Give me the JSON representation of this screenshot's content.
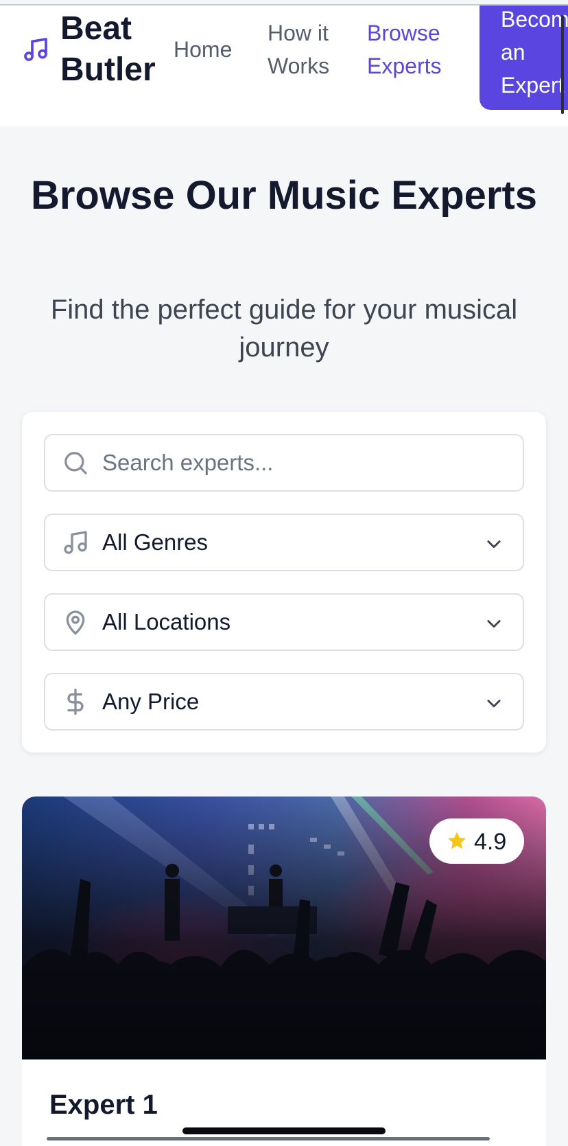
{
  "header": {
    "brand": "Beat\nButler",
    "logo_icon": "music-note-icon",
    "nav": [
      {
        "label": "Home",
        "active": false
      },
      {
        "label": "How it\nWorks",
        "active": false
      },
      {
        "label": "Browse\nExperts",
        "active": true
      }
    ],
    "cta_label": "Become\nan\nExpert"
  },
  "hero": {
    "title": "Browse Our Music Experts",
    "subtitle": "Find the perfect guide for your musical journey"
  },
  "filters": {
    "search": {
      "placeholder": "Search experts...",
      "icon": "search-icon"
    },
    "genre": {
      "value": "All Genres",
      "icon": "music-note-icon"
    },
    "location": {
      "value": "All Locations",
      "icon": "map-pin-icon"
    },
    "price": {
      "value": "Any Price",
      "icon": "dollar-icon"
    }
  },
  "experts": [
    {
      "name": "Expert 1",
      "rating": "4.9",
      "image": "concert-crowd-photo"
    }
  ],
  "colors": {
    "accent": "#5b45e0",
    "text": "#141a2e",
    "muted": "#555d6b",
    "background": "#f5f6f7",
    "star": "#f5c518"
  }
}
